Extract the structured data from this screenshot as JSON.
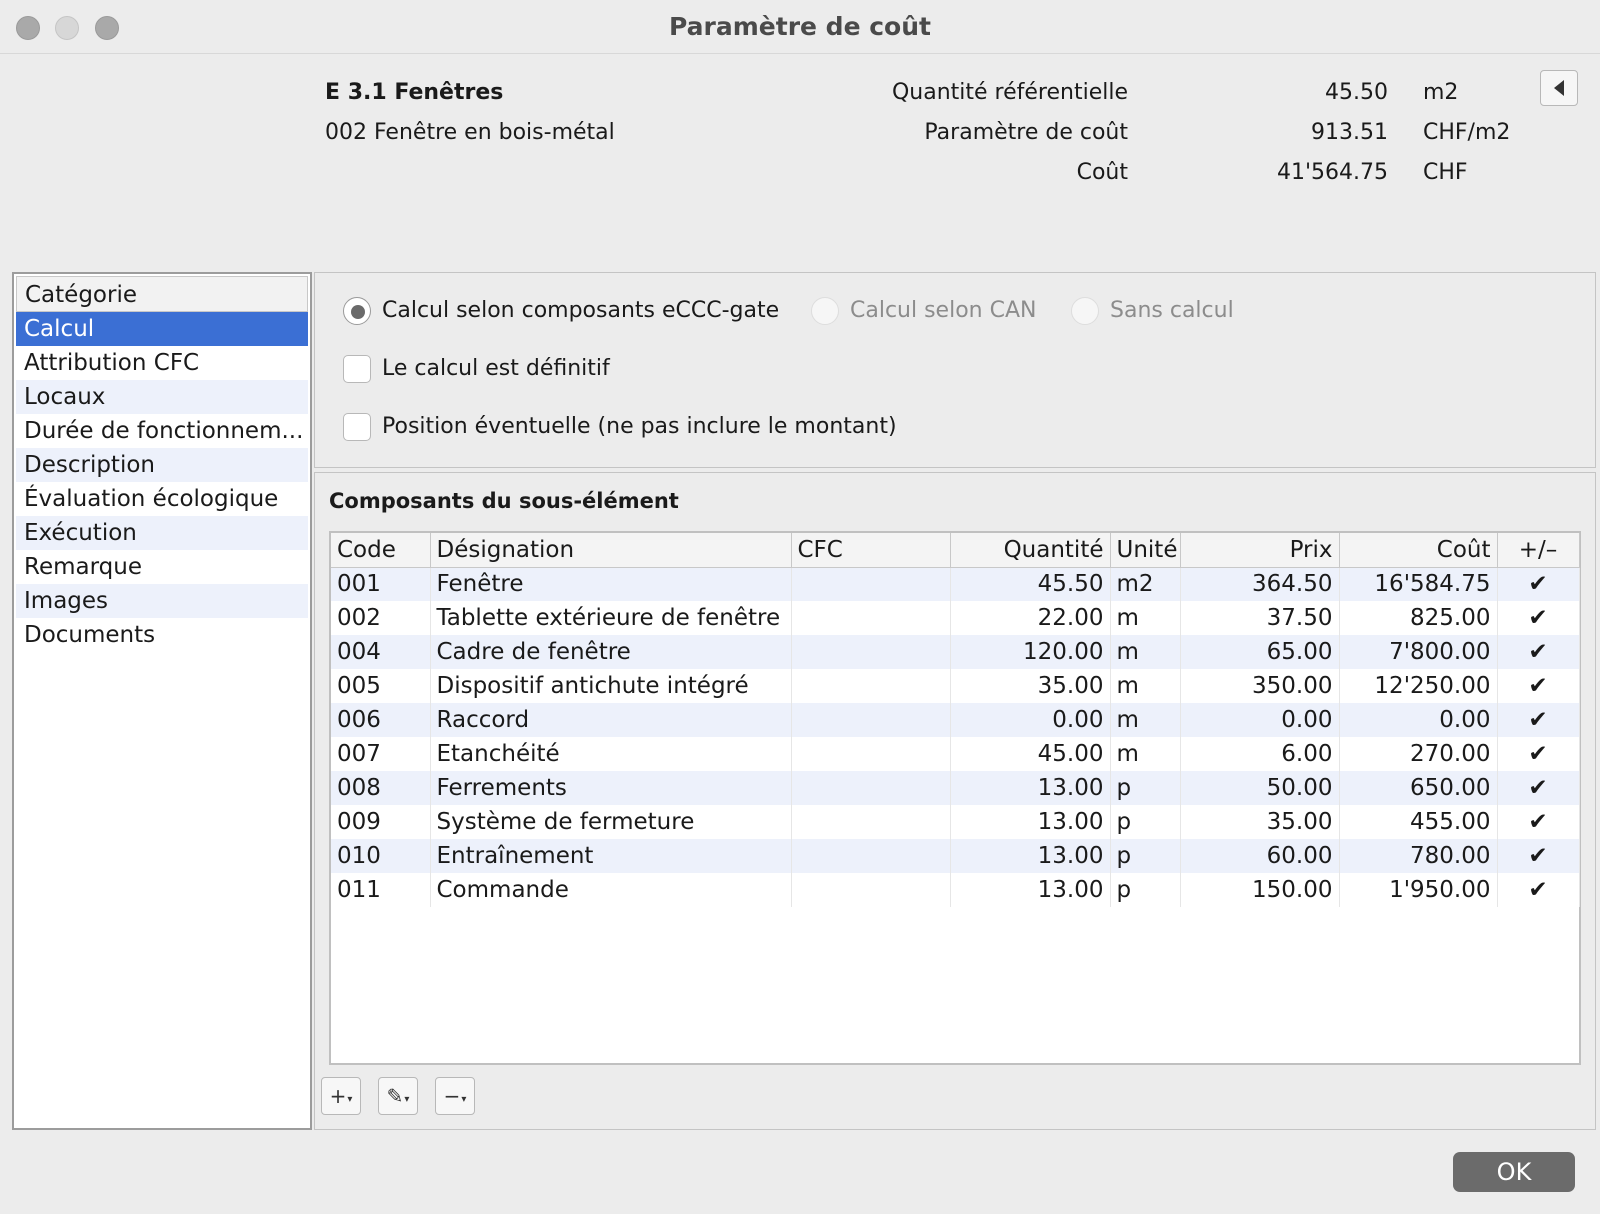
{
  "window": {
    "title": "Paramètre de coût"
  },
  "header": {
    "element_code": "E 3.1 Fenêtres",
    "sub_element": "002 Fenêtre en bois-métal",
    "metrics": [
      {
        "label": "Quantité référentielle",
        "value": "45.50",
        "unit": "m2"
      },
      {
        "label": "Paramètre de coût",
        "value": "913.51",
        "unit": "CHF/m2"
      },
      {
        "label": "Coût",
        "value": "41'564.75",
        "unit": "CHF"
      }
    ]
  },
  "sidebar": {
    "header": "Catégorie",
    "items": [
      {
        "label": "Calcul"
      },
      {
        "label": "Attribution CFC"
      },
      {
        "label": "Locaux"
      },
      {
        "label": "Durée de fonctionnem..."
      },
      {
        "label": "Description"
      },
      {
        "label": "Évaluation écologique"
      },
      {
        "label": "Exécution"
      },
      {
        "label": "Remarque"
      },
      {
        "label": "Images"
      },
      {
        "label": "Documents"
      }
    ],
    "selected": "Calcul"
  },
  "options": {
    "radios": [
      {
        "label": "Calcul selon composants eCCC-gate",
        "checked": true
      },
      {
        "label": "Calcul selon CAN",
        "checked": false
      },
      {
        "label": "Sans calcul",
        "checked": false
      }
    ],
    "checkboxes": [
      {
        "label": "Le calcul est définitif",
        "checked": false
      },
      {
        "label": "Position éventuelle (ne pas inclure le montant)",
        "checked": false
      }
    ]
  },
  "components": {
    "title": "Composants du sous-élément",
    "columns": [
      "Code",
      "Désignation",
      "CFC",
      "Quantité",
      "Unité",
      "Prix",
      "Coût",
      "+/–"
    ],
    "rows": [
      {
        "code": "001",
        "designation": "Fenêtre",
        "cfc": "",
        "quantite": "45.50",
        "unite": "m2",
        "prix": "364.50",
        "cout": "16'584.75",
        "check": "✔"
      },
      {
        "code": "002",
        "designation": "Tablette extérieure de fenêtre",
        "cfc": "",
        "quantite": "22.00",
        "unite": "m",
        "prix": "37.50",
        "cout": "825.00",
        "check": "✔"
      },
      {
        "code": "004",
        "designation": "Cadre de fenêtre",
        "cfc": "",
        "quantite": "120.00",
        "unite": "m",
        "prix": "65.00",
        "cout": "7'800.00",
        "check": "✔"
      },
      {
        "code": "005",
        "designation": "Dispositif antichute intégré",
        "cfc": "",
        "quantite": "35.00",
        "unite": "m",
        "prix": "350.00",
        "cout": "12'250.00",
        "check": "✔"
      },
      {
        "code": "006",
        "designation": "Raccord",
        "cfc": "",
        "quantite": "0.00",
        "unite": "m",
        "prix": "0.00",
        "cout": "0.00",
        "check": "✔"
      },
      {
        "code": "007",
        "designation": "Etanchéité",
        "cfc": "",
        "quantite": "45.00",
        "unite": "m",
        "prix": "6.00",
        "cout": "270.00",
        "check": "✔"
      },
      {
        "code": "008",
        "designation": "Ferrements",
        "cfc": "",
        "quantite": "13.00",
        "unite": "p",
        "prix": "50.00",
        "cout": "650.00",
        "check": "✔"
      },
      {
        "code": "009",
        "designation": "Système de fermeture",
        "cfc": "",
        "quantite": "13.00",
        "unite": "p",
        "prix": "35.00",
        "cout": "455.00",
        "check": "✔"
      },
      {
        "code": "010",
        "designation": "Entraînement",
        "cfc": "",
        "quantite": "13.00",
        "unite": "p",
        "prix": "60.00",
        "cout": "780.00",
        "check": "✔"
      },
      {
        "code": "011",
        "designation": "Commande",
        "cfc": "",
        "quantite": "13.00",
        "unite": "p",
        "prix": "150.00",
        "cout": "1'950.00",
        "check": "✔"
      }
    ]
  },
  "toolbar": {
    "add_icon": "+",
    "edit_icon": "✎",
    "remove_icon": "−",
    "dropdown_caret": "▾"
  },
  "footer": {
    "ok_label": "OK"
  },
  "icons": {
    "collapse": "triangle-left-icon"
  },
  "colors": {
    "selection": "#3b6fd4",
    "row_alt": "#edf1fb",
    "ok_button": "#6b6b6b"
  }
}
